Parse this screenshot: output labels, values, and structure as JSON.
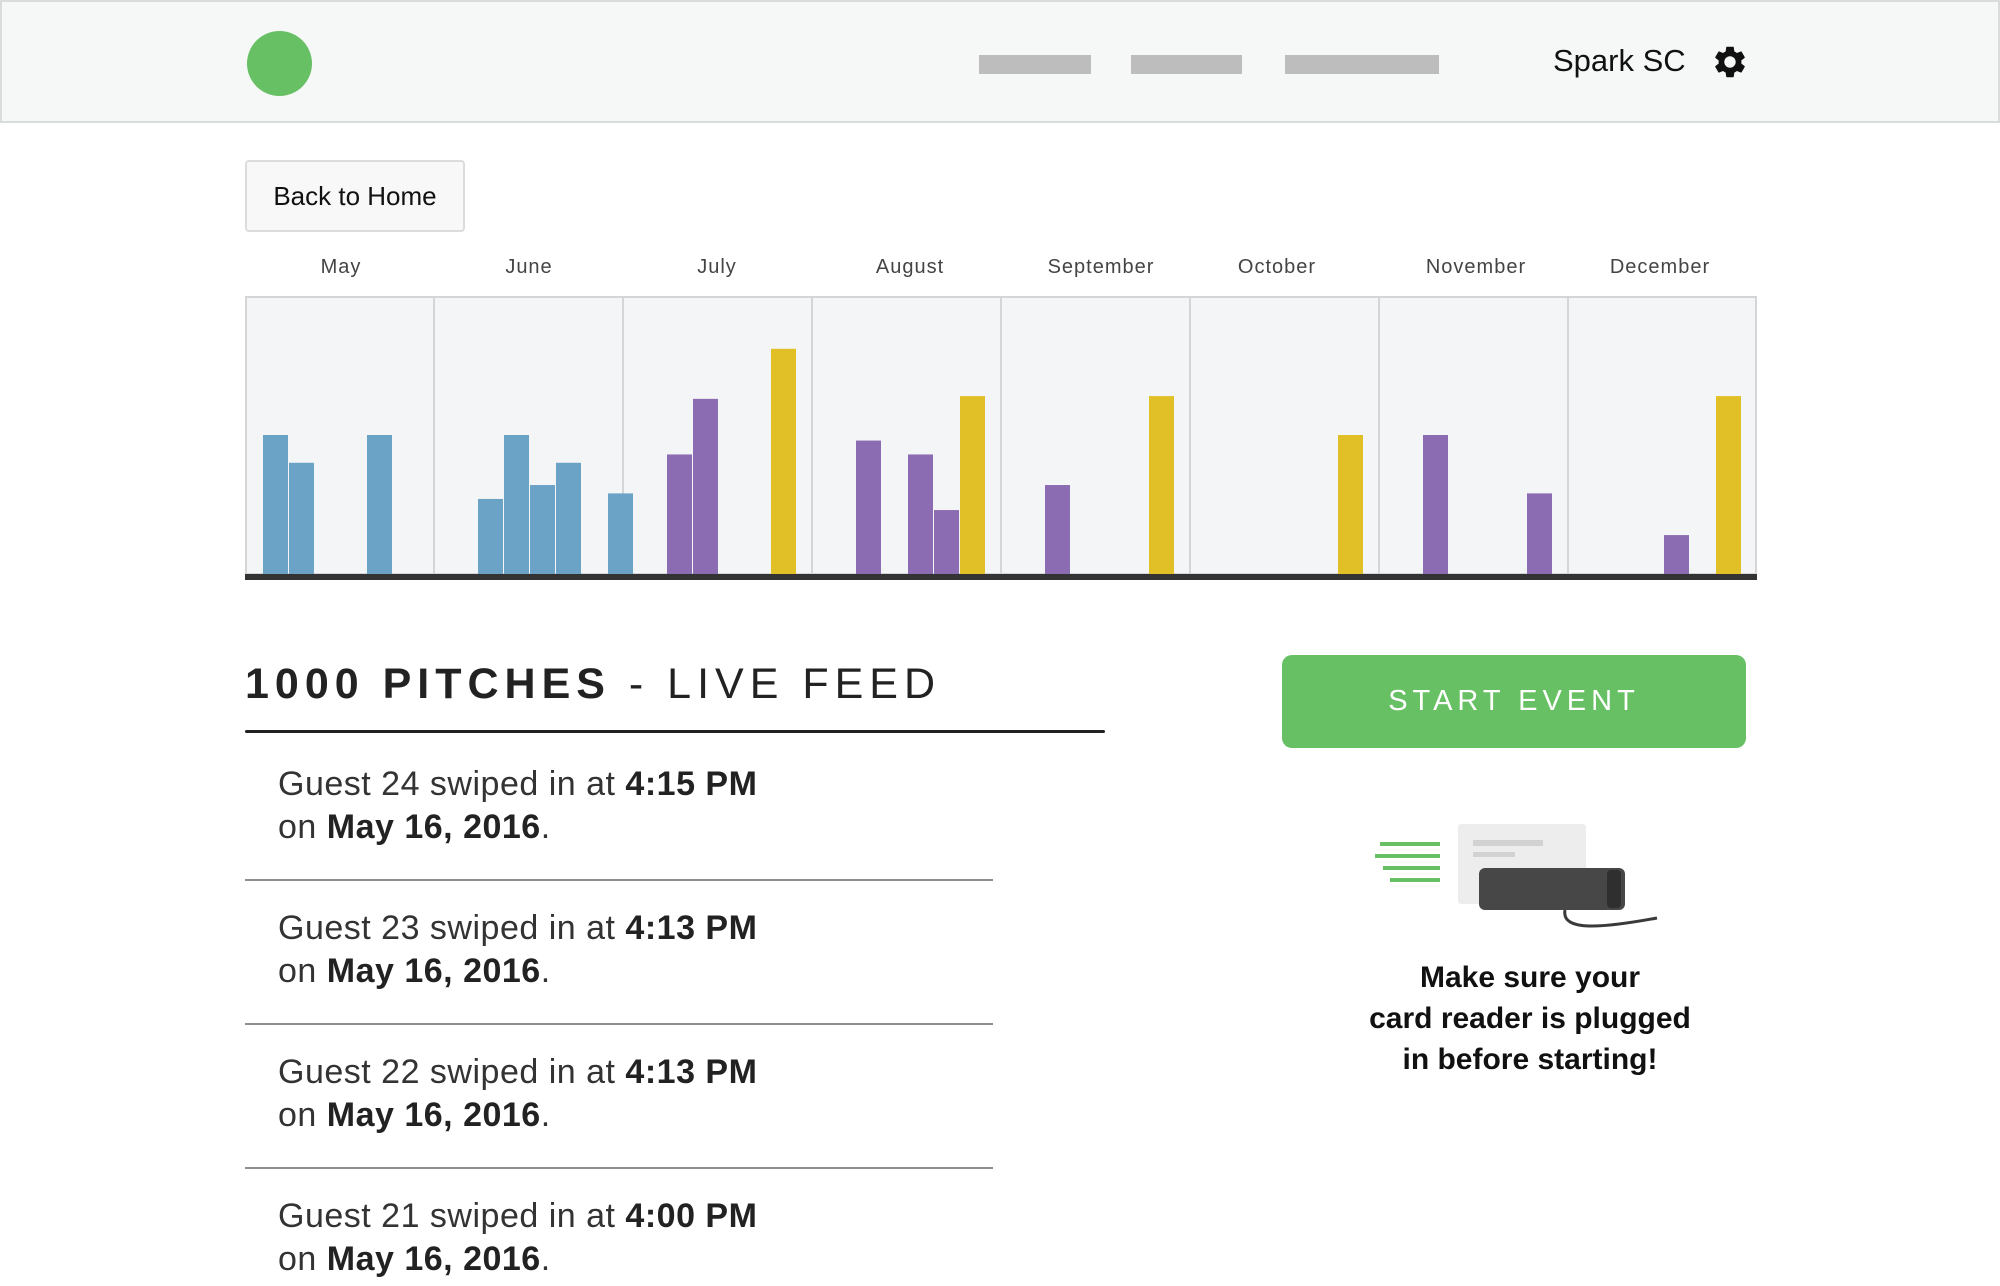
{
  "header": {
    "account_name": "Spark SC",
    "icons": {
      "logo": "green-circle-logo",
      "settings": "gear-icon"
    },
    "nav_placeholders": 3
  },
  "back_button": {
    "label": "Back to Home"
  },
  "chart_data": {
    "type": "bar",
    "title": "",
    "categories": [
      "May",
      "June",
      "July",
      "August",
      "September",
      "October",
      "November",
      "December"
    ],
    "ylim": [
      0,
      100
    ],
    "grid": "vertical separators per month",
    "colors": {
      "blue": "#6aa3c6",
      "purple": "#8b6bb1",
      "yellow": "#e1bf27"
    },
    "bars": [
      [
        {
          "slot": 0,
          "value": 50,
          "color": "blue"
        },
        {
          "slot": 1,
          "value": 40,
          "color": "blue"
        },
        {
          "slot": 4,
          "value": 50,
          "color": "blue"
        }
      ],
      [
        {
          "slot": 1,
          "value": 27,
          "color": "blue"
        },
        {
          "slot": 2,
          "value": 50,
          "color": "blue"
        },
        {
          "slot": 3,
          "value": 32,
          "color": "blue"
        },
        {
          "slot": 4,
          "value": 40,
          "color": "blue"
        },
        {
          "slot": 6,
          "value": 29,
          "color": "blue"
        }
      ],
      [
        {
          "slot": 1,
          "value": 43,
          "color": "purple"
        },
        {
          "slot": 2,
          "value": 63,
          "color": "purple"
        },
        {
          "slot": 5,
          "value": 81,
          "color": "yellow"
        }
      ],
      [
        {
          "slot": 1,
          "value": 48,
          "color": "purple"
        },
        {
          "slot": 3,
          "value": 43,
          "color": "purple"
        },
        {
          "slot": 4,
          "value": 23,
          "color": "purple"
        },
        {
          "slot": 5,
          "value": 64,
          "color": "yellow"
        }
      ],
      [
        {
          "slot": 1,
          "value": 32,
          "color": "purple"
        },
        {
          "slot": 5,
          "value": 64,
          "color": "yellow"
        }
      ],
      [
        {
          "slot": 5,
          "value": 50,
          "color": "yellow"
        }
      ],
      [
        {
          "slot": 1,
          "value": 50,
          "color": "purple"
        },
        {
          "slot": 5,
          "value": 29,
          "color": "purple"
        }
      ],
      [
        {
          "slot": 3,
          "value": 14,
          "color": "purple"
        },
        {
          "slot": 5,
          "value": 64,
          "color": "yellow"
        }
      ]
    ]
  },
  "feed": {
    "title_bold": "1000 PITCHES",
    "title_rest": " - LIVE FEED",
    "items": [
      {
        "prefix": "Guest 24 swiped in at ",
        "time": "4:15 PM",
        "on": "on ",
        "date": "May 16, 2016",
        "suffix": "."
      },
      {
        "prefix": "Guest 23 swiped in at ",
        "time": "4:13 PM",
        "on": "on ",
        "date": "May 16, 2016",
        "suffix": "."
      },
      {
        "prefix": "Guest 22 swiped in at ",
        "time": "4:13 PM",
        "on": "on ",
        "date": "May 16, 2016",
        "suffix": "."
      },
      {
        "prefix": "Guest 21 swiped in at ",
        "time": "4:00 PM",
        "on": "on ",
        "date": "May 16, 2016",
        "suffix": "."
      }
    ]
  },
  "start_button": {
    "label": "START EVENT",
    "color": "#67c063"
  },
  "reader_note": "Make sure your\ncard reader is plugged\nin before starting!",
  "reader_icon": "card-reader-icon"
}
